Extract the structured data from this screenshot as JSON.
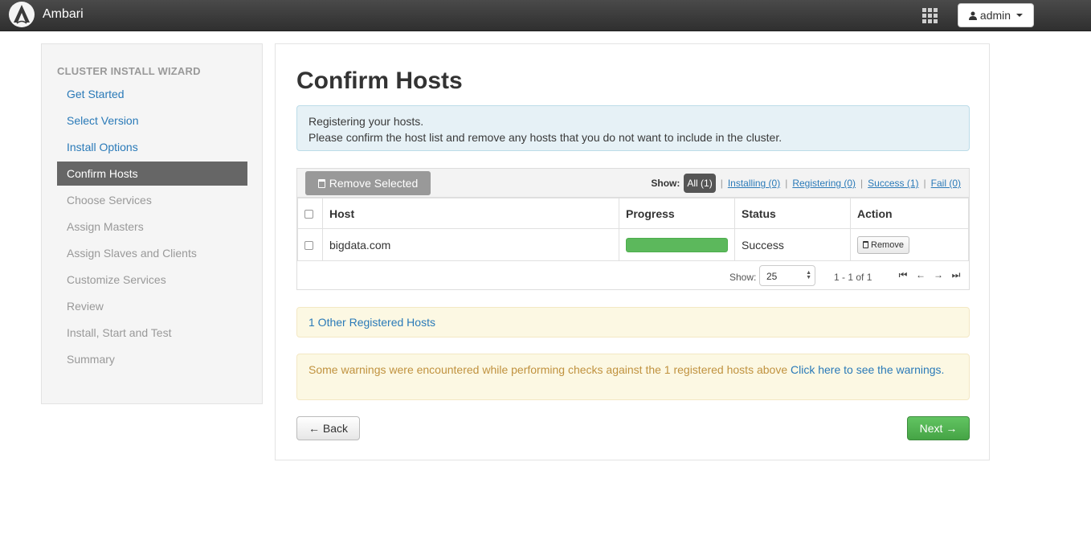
{
  "navbar": {
    "brand": "Ambari",
    "user_label": "admin",
    "apps_icon": "grid-icon",
    "user_icon": "user-icon"
  },
  "sidebar": {
    "title": "CLUSTER INSTALL WIZARD",
    "items": [
      {
        "label": "Get Started",
        "state": "done"
      },
      {
        "label": "Select Version",
        "state": "done"
      },
      {
        "label": "Install Options",
        "state": "done"
      },
      {
        "label": "Confirm Hosts",
        "state": "active"
      },
      {
        "label": "Choose Services",
        "state": "pending"
      },
      {
        "label": "Assign Masters",
        "state": "pending"
      },
      {
        "label": "Assign Slaves and Clients",
        "state": "pending"
      },
      {
        "label": "Customize Services",
        "state": "pending"
      },
      {
        "label": "Review",
        "state": "pending"
      },
      {
        "label": "Install, Start and Test",
        "state": "pending"
      },
      {
        "label": "Summary",
        "state": "pending"
      }
    ]
  },
  "main": {
    "title": "Confirm Hosts",
    "info_line1": "Registering your hosts.",
    "info_line2": "Please confirm the host list and remove any hosts that you do not want to include in the cluster.",
    "remove_selected_label": "Remove Selected",
    "filters": {
      "show_label": "Show:",
      "all": "All (1)",
      "installing": "Installing (0)",
      "registering": "Registering (0)",
      "success": "Success (1)",
      "fail": "Fail (0)"
    },
    "table": {
      "columns": [
        "Host",
        "Progress",
        "Status",
        "Action"
      ],
      "rows": [
        {
          "host": "bigdata.com",
          "progress": 1.0,
          "status": "Success",
          "action": "Remove"
        }
      ]
    },
    "pager": {
      "show_label": "Show:",
      "page_size": "25",
      "range": "1 - 1 of 1"
    },
    "other_hosts_link": "1 Other Registered Hosts",
    "warning_text": "Some warnings were encountered while performing checks against the 1 registered hosts above ",
    "warning_link": "Click here to see the warnings.",
    "back_label": "← Back",
    "next_label": "Next →"
  },
  "colors": {
    "accent_link": "#2a7ab8",
    "success": "#5cb85c",
    "navbar": "#3a3a3a",
    "warning_text": "#c0923f"
  }
}
